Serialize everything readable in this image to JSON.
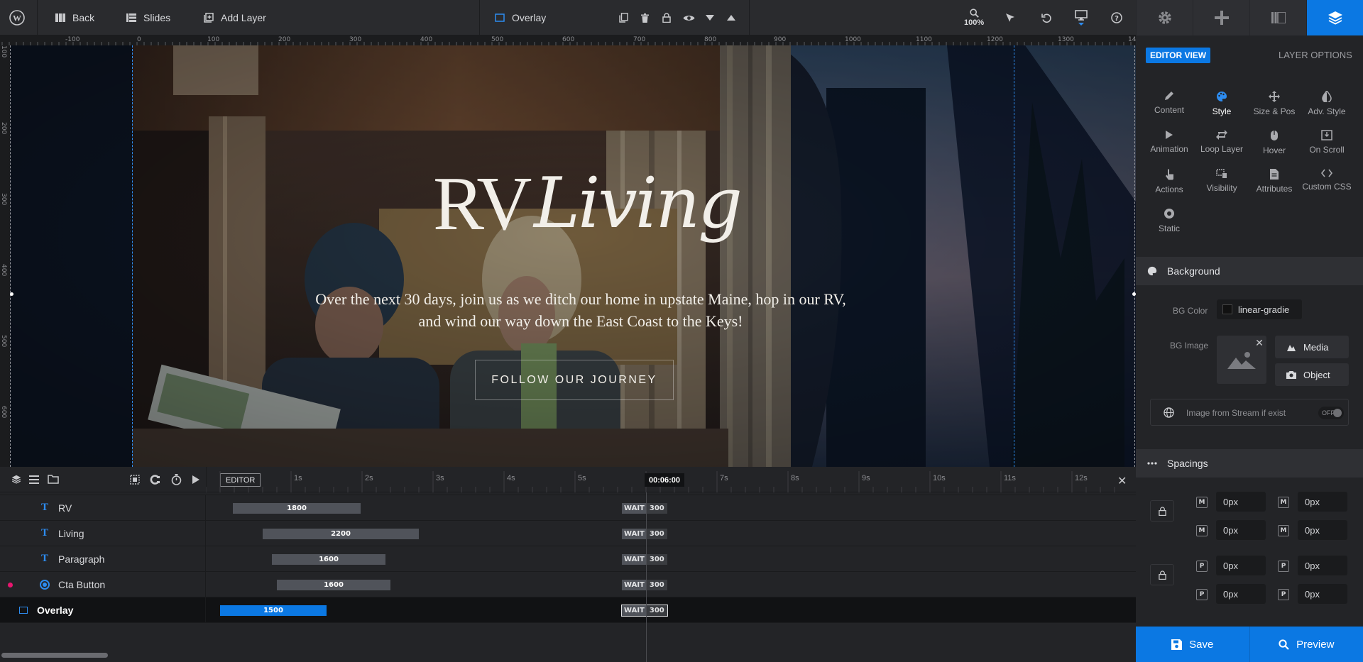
{
  "topbar": {
    "back_label": "Back",
    "slides_label": "Slides",
    "add_layer_label": "Add Layer",
    "current_layer": "Overlay",
    "zoom": "100%"
  },
  "colors": {
    "accent": "#0b78e3",
    "panel_bg": "#232427",
    "topbar_bg": "#2a2b2e",
    "bar_gray": "#50535a",
    "overlay_bar": "#0b78e3",
    "guide": "#2d8cf0",
    "record_dot": "#e9156f"
  },
  "ruler": {
    "h_labels": [
      "-100",
      "0",
      "100",
      "200",
      "300",
      "400",
      "500",
      "600",
      "700",
      "800",
      "900",
      "1000",
      "1100",
      "1200",
      "1300",
      "14"
    ],
    "v_labels": [
      "100",
      "200",
      "300",
      "400",
      "500",
      "600"
    ]
  },
  "slide": {
    "title_rv": "RV",
    "title_living": "Living",
    "paragraph_line1": "Over the next 30 days, join us as we ditch our home in upstate Maine, hop in our RV,",
    "paragraph_line2": "and wind our way down the East Coast to the Keys!",
    "cta": "FOLLOW OUR JOURNEY"
  },
  "panel": {
    "editor_view": "EDITOR VIEW",
    "layer_options": "LAYER OPTIONS",
    "tabs": [
      {
        "label": "Content",
        "icon": "pencil-icon"
      },
      {
        "label": "Style",
        "icon": "palette-icon"
      },
      {
        "label": "Size & Pos",
        "icon": "move-icon"
      },
      {
        "label": "Adv. Style",
        "icon": "contrast-icon"
      },
      {
        "label": "Animation",
        "icon": "play-icon"
      },
      {
        "label": "Loop Layer",
        "icon": "loop-icon"
      },
      {
        "label": "Hover",
        "icon": "mouse-icon"
      },
      {
        "label": "On Scroll",
        "icon": "scroll-icon"
      },
      {
        "label": "Actions",
        "icon": "pointer-icon"
      },
      {
        "label": "Visibility",
        "icon": "visibility-icon"
      },
      {
        "label": "Attributes",
        "icon": "document-icon"
      },
      {
        "label": "Custom CSS",
        "icon": "code-icon"
      },
      {
        "label": "Static",
        "icon": "target-icon"
      }
    ],
    "active_tab": "Style",
    "background": {
      "title": "Background",
      "bg_color_label": "BG Color",
      "bg_color_value": "linear-gradie",
      "bg_image_label": "BG Image",
      "media_label": "Media",
      "object_label": "Object",
      "stream_label": "Image from Stream if exist",
      "stream_toggle": "OFF"
    },
    "spacings": {
      "title": "Spacings",
      "margin_icon": "M",
      "padding_icon": "P",
      "values": [
        "0px",
        "0px",
        "0px",
        "0px",
        "0px",
        "0px",
        "0px",
        "0px"
      ]
    },
    "save_label": "Save",
    "preview_label": "Preview"
  },
  "timeline": {
    "editor_label": "EDITOR",
    "ticks": [
      "1s",
      "2s",
      "3s",
      "4s",
      "5s",
      "7s",
      "8s",
      "9s",
      "10s",
      "11s",
      "12s"
    ],
    "current_time": "00:06:00",
    "layers": [
      {
        "name": "RV",
        "type": "text",
        "bar": "1800",
        "wait": "WAIT",
        "wait_val": "300"
      },
      {
        "name": "Living",
        "type": "text",
        "bar": "2200",
        "wait": "WAIT",
        "wait_val": "300"
      },
      {
        "name": "Paragraph",
        "type": "text",
        "bar": "1600",
        "wait": "WAIT",
        "wait_val": "300"
      },
      {
        "name": "Cta Button",
        "type": "button",
        "bar": "1600",
        "wait": "WAIT",
        "wait_val": "300"
      },
      {
        "name": "Overlay",
        "type": "shape",
        "bar": "1500",
        "wait": "WAIT",
        "wait_val": "300"
      }
    ]
  }
}
